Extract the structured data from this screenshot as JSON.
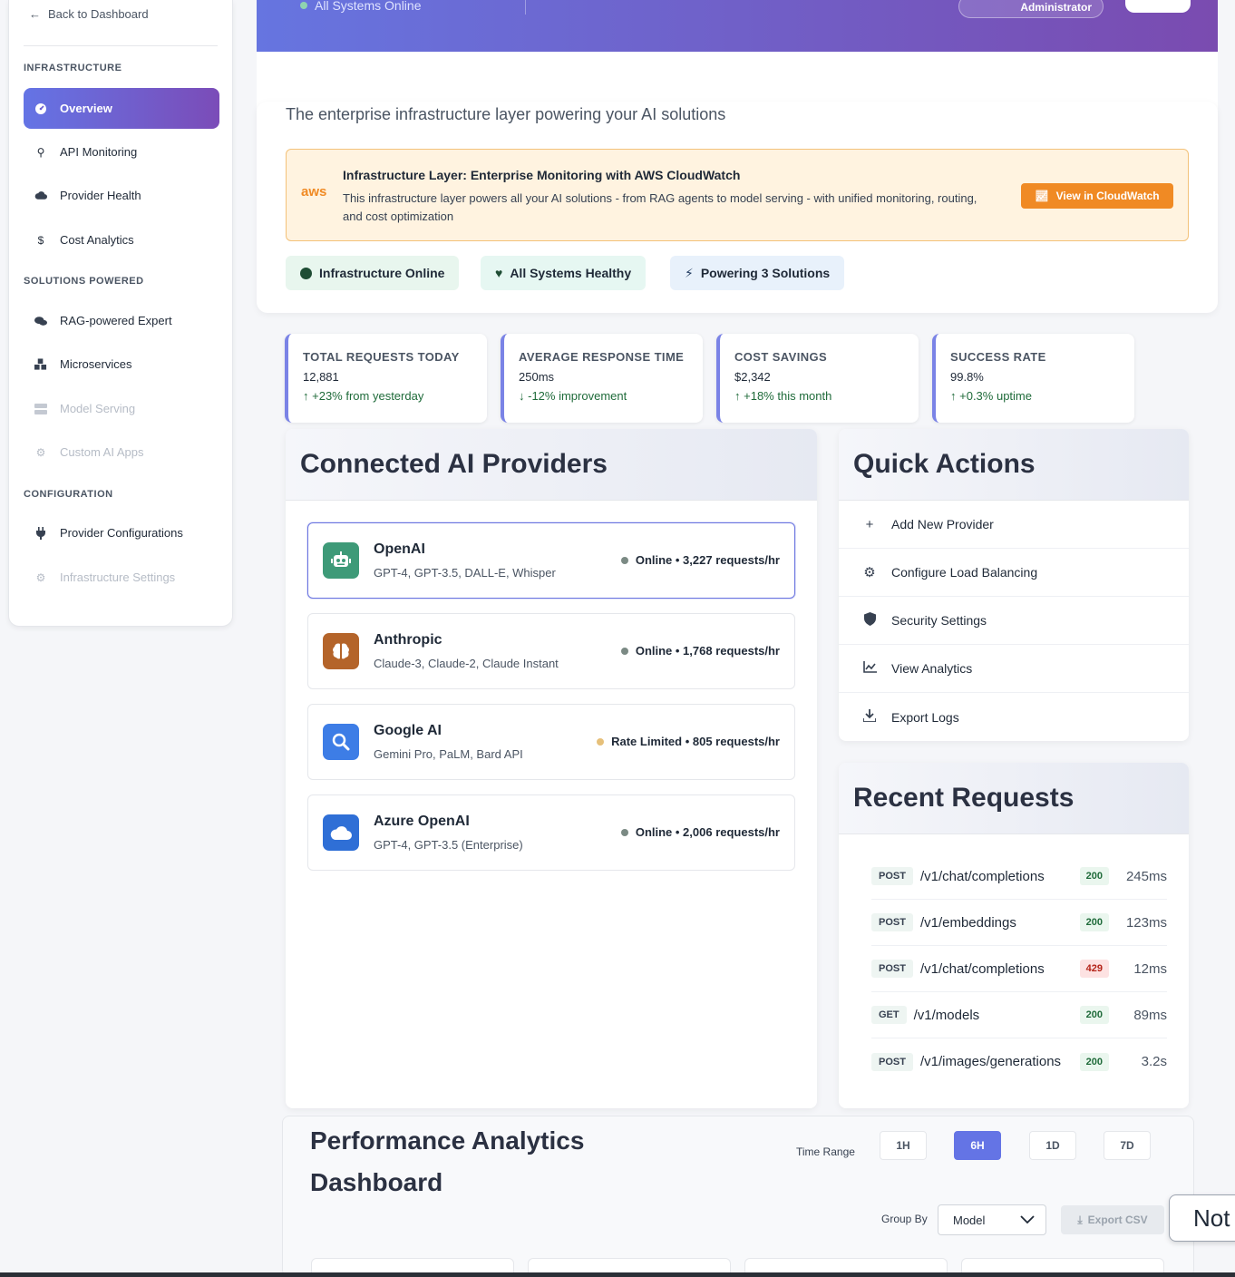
{
  "sidebar": {
    "back_label": "Back to Dashboard",
    "sections": {
      "infrastructure": "INFRASTRUCTURE",
      "solutions": "SOLUTIONS POWERED",
      "configuration": "CONFIGURATION"
    },
    "items": [
      {
        "label": "Overview",
        "icon": "gauge-icon"
      },
      {
        "label": "API Monitoring",
        "icon": "monitor-icon"
      },
      {
        "label": "Provider Health",
        "icon": "cloud-icon"
      },
      {
        "label": "Cost Analytics",
        "icon": "dollar-icon"
      },
      {
        "label": "RAG-powered Expert",
        "icon": "chat-icon"
      },
      {
        "label": "Microservices",
        "icon": "cubes-icon"
      },
      {
        "label": "Model Serving",
        "icon": "server-icon"
      },
      {
        "label": "Custom AI Apps",
        "icon": "cogs-icon"
      },
      {
        "label": "Provider Configurations",
        "icon": "plug-icon"
      },
      {
        "label": "Infrastructure Settings",
        "icon": "gear-icon"
      }
    ]
  },
  "header": {
    "status": "All Systems Online",
    "role": "Administrator"
  },
  "intro": {
    "tagline": "The enterprise infrastructure layer powering your AI solutions",
    "aws": {
      "logo": "aws",
      "title": "Infrastructure Layer: Enterprise Monitoring with AWS CloudWatch",
      "description": "This infrastructure layer powers all your AI solutions - from RAG agents to model serving - with unified monitoring, routing, and cost optimization",
      "button": "View in CloudWatch"
    },
    "pills": [
      "Infrastructure Online",
      "All Systems Healthy",
      "Powering 3 Solutions"
    ]
  },
  "stats": [
    {
      "label": "TOTAL REQUESTS TODAY",
      "value": "12,881",
      "delta": "+23% from yesterday",
      "arrow": "↑"
    },
    {
      "label": "AVERAGE RESPONSE TIME",
      "value": "250ms",
      "delta": "-12% improvement",
      "arrow": "↓"
    },
    {
      "label": "COST SAVINGS",
      "value": "$2,342",
      "delta": "+18% this month",
      "arrow": "↑"
    },
    {
      "label": "SUCCESS RATE",
      "value": "99.8%",
      "delta": "+0.3% uptime",
      "arrow": "↑"
    }
  ],
  "providers_panel": {
    "title": "Connected AI Providers",
    "providers": [
      {
        "name": "OpenAI",
        "models": "GPT-4, GPT-3.5, DALL-E, Whisper",
        "status": "Online • 3,227 requests/hr",
        "color": "#3e9a78",
        "status_color": "#7b8a84",
        "icon": "robot-icon"
      },
      {
        "name": "Anthropic",
        "models": "Claude-3, Claude-2, Claude Instant",
        "status": "Online • 1,768 requests/hr",
        "color": "#b4642a",
        "status_color": "#7b8a84",
        "icon": "brain-icon"
      },
      {
        "name": "Google AI",
        "models": "Gemini Pro, PaLM, Bard API",
        "status": "Rate Limited • 805 requests/hr",
        "color": "#3d7de6",
        "status_color": "#e6c07a",
        "icon": "search-icon"
      },
      {
        "name": "Azure OpenAI",
        "models": "GPT-4, GPT-3.5 (Enterprise)",
        "status": "Online • 2,006 requests/hr",
        "color": "#2f6fd6",
        "status_color": "#7b8a84",
        "icon": "cloud-icon"
      }
    ]
  },
  "quick_actions": {
    "title": "Quick Actions",
    "items": [
      {
        "label": "Add New Provider",
        "icon": "plus-icon"
      },
      {
        "label": "Configure Load Balancing",
        "icon": "gear-icon"
      },
      {
        "label": "Security Settings",
        "icon": "shield-icon"
      },
      {
        "label": "View Analytics",
        "icon": "chart-line-icon"
      },
      {
        "label": "Export Logs",
        "icon": "download-icon"
      }
    ]
  },
  "recent_requests": {
    "title": "Recent Requests",
    "rows": [
      {
        "method": "POST",
        "path": "/v1/chat/completions",
        "code": "200",
        "latency": "245ms"
      },
      {
        "method": "POST",
        "path": "/v1/embeddings",
        "code": "200",
        "latency": "123ms"
      },
      {
        "method": "POST",
        "path": "/v1/chat/completions",
        "code": "429",
        "latency": "12ms"
      },
      {
        "method": "GET",
        "path": "/v1/models",
        "code": "200",
        "latency": "89ms"
      },
      {
        "method": "POST",
        "path": "/v1/images/generations",
        "code": "200",
        "latency": "3.2s"
      }
    ]
  },
  "performance": {
    "title": "Performance Analytics Dashboard",
    "time_range_label": "Time Range",
    "ranges": [
      "1H",
      "6H",
      "1D",
      "7D"
    ],
    "active_range": "6H",
    "group_by_label": "Group By",
    "group_by_value": "Model",
    "export_label": "Export CSV"
  },
  "toast": {
    "text": "Not"
  }
}
